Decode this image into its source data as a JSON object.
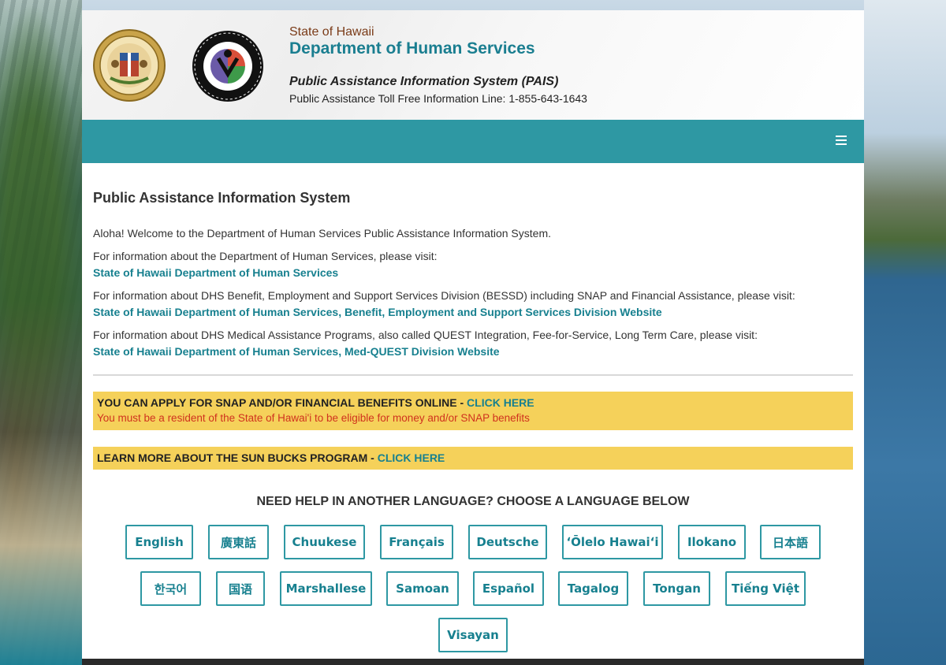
{
  "header": {
    "state": "State of Hawaii",
    "department": "Department of Human Services",
    "system_name": "Public Assistance Information System (PAIS)",
    "toll_free": "Public Assistance Toll Free Information Line: 1-855-643-1643"
  },
  "main": {
    "title": "Public Assistance Information System",
    "welcome": "Aloha! Welcome to the Department of Human Services Public Assistance Information System.",
    "info_dhs": "For information about the Department of Human Services, please visit:",
    "link_dhs": "State of Hawaii Department of Human Services",
    "info_bessd": "For information about DHS Benefit, Employment and Support Services Division (BESSD) including SNAP and Financial Assistance, please visit:",
    "link_bessd": "State of Hawaii Department of Human Services, Benefit, Employment and Support Services Division Website",
    "info_medquest": "For information about DHS Medical Assistance Programs, also called QUEST Integration, Fee-for-Service, Long Term Care, please visit:",
    "link_medquest": "State of Hawaii Department of Human Services, Med-QUEST Division Website"
  },
  "banners": {
    "apply_text": "YOU CAN APPLY FOR SNAP AND/OR FINANCIAL BENEFITS ONLINE - ",
    "apply_link": "CLICK HERE",
    "apply_note": "You must be a resident of the State of Hawai'i to be eligible for money and/or SNAP benefits",
    "sunbucks_text": "LEARN MORE ABOUT THE SUN BUCKS PROGRAM - ",
    "sunbucks_link": "CLICK HERE"
  },
  "languages": {
    "heading": "NEED HELP IN ANOTHER LANGUAGE? CHOOSE A LANGUAGE BELOW",
    "items": [
      "English",
      "廣東話",
      "Chuukese",
      "Français",
      "Deutsche",
      "ʻŌlelo Hawaiʻi",
      "Ilokano",
      "日本語",
      "한국어",
      "国语",
      "Marshallese",
      "Samoan",
      "Español",
      "Tagalog",
      "Tongan",
      "Tiếng Việt",
      "Visayan"
    ]
  },
  "colors": {
    "teal": "#2e98a3",
    "link": "#17808f",
    "banner": "#f5d15a",
    "warning": "#d0321e"
  },
  "icons": {
    "seal": "state-seal-icon",
    "dhs": "dhs-logo-icon",
    "menu": "hamburger-menu-icon"
  }
}
